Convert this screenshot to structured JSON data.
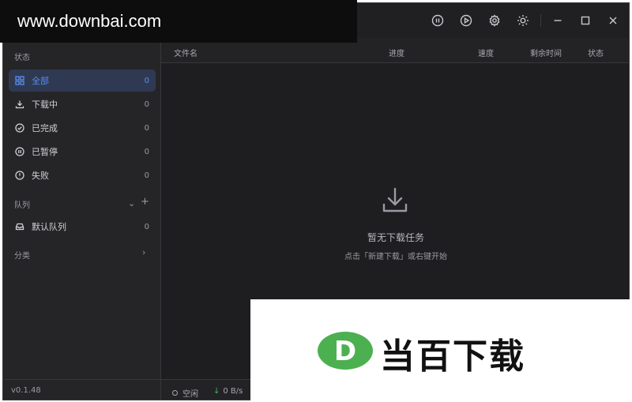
{
  "watermark": {
    "site": "www.downbai.com",
    "brand_text": "当百下载",
    "brand_letter": "D"
  },
  "titlebar": {
    "icons": [
      "pause-all-icon",
      "start-all-icon",
      "settings-icon",
      "theme-icon",
      "minimize-icon",
      "maximize-icon",
      "close-icon"
    ]
  },
  "sidebar": {
    "status_title": "状态",
    "items": [
      {
        "label": "全部",
        "count": "0",
        "icon": "grid-icon",
        "active": true
      },
      {
        "label": "下载中",
        "count": "0",
        "icon": "download-icon"
      },
      {
        "label": "已完成",
        "count": "0",
        "icon": "check-circle-icon"
      },
      {
        "label": "已暂停",
        "count": "0",
        "icon": "pause-circle-icon"
      },
      {
        "label": "失败",
        "count": "0",
        "icon": "alert-circle-icon"
      }
    ],
    "queue_title": "队列",
    "queue_items": [
      {
        "label": "默认队列",
        "count": "0",
        "icon": "inbox-icon"
      }
    ],
    "category_title": "分类",
    "version": "v0.1.48"
  },
  "table": {
    "columns": [
      "文件名",
      "进度",
      "速度",
      "剩余时间",
      "状态"
    ]
  },
  "empty": {
    "title": "暂无下载任务",
    "hint": "点击「新建下载」或右键开始"
  },
  "statusbar": {
    "state": "空闲",
    "speed": "0 B/s"
  },
  "colors": {
    "accent": "#5a8cf0",
    "background": "#252528",
    "speed_arrow": "#3fb463",
    "badge_green": "#4cb050"
  }
}
